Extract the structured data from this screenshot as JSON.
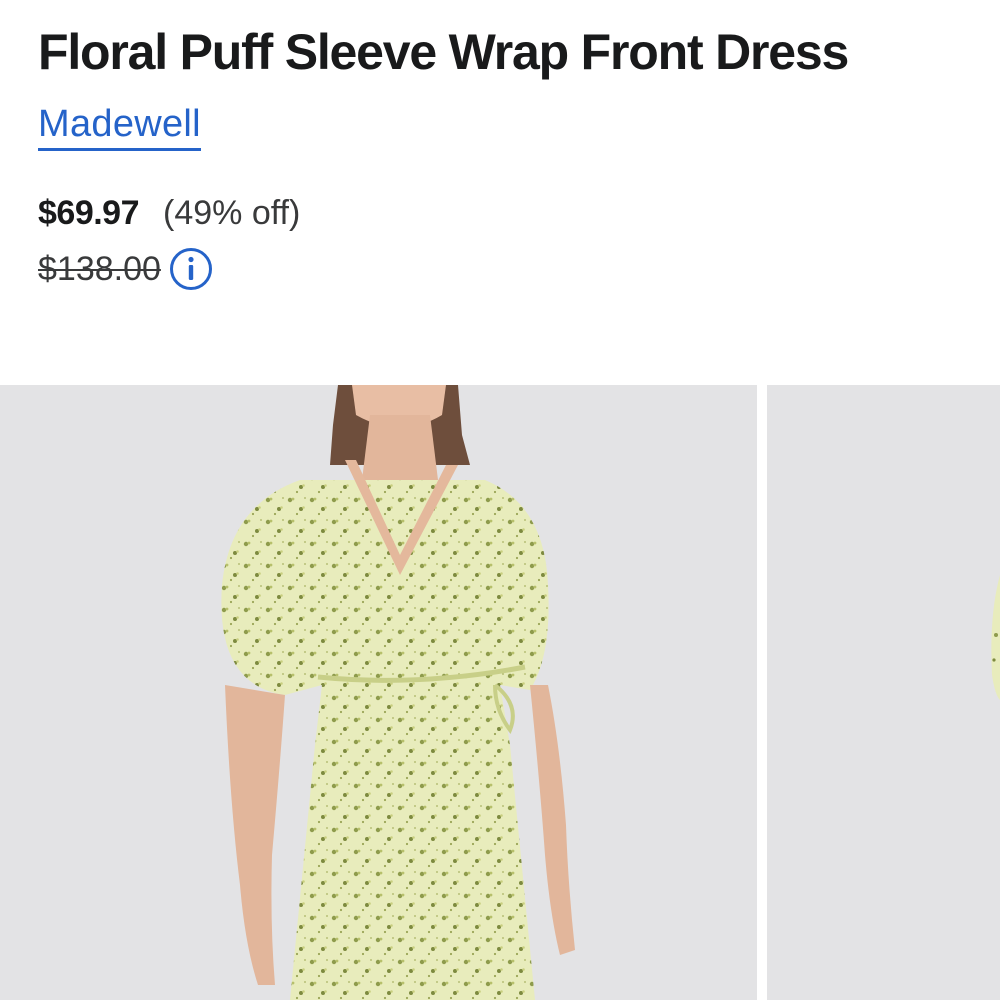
{
  "product": {
    "title": "Floral Puff Sleeve Wrap Front Dress",
    "brand": "Madewell",
    "sale_price": "$69.97",
    "discount": "(49% off)",
    "original_price": "$138.00"
  },
  "icons": {
    "price_info": "info-circle-icon"
  },
  "colors": {
    "brand_link": "#2563c9",
    "text_primary": "#191a1b",
    "photo_background": "#e3e3e5",
    "dress": "#e7ebb9"
  }
}
